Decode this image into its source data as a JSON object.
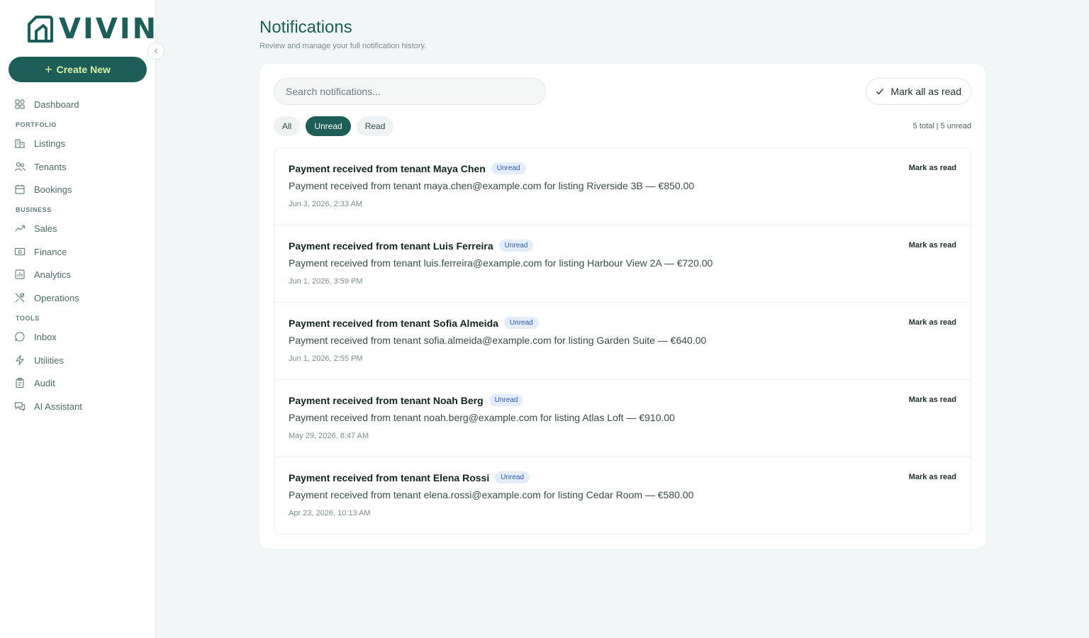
{
  "brand": {
    "name": "VIVIN",
    "color": "#1d5e58"
  },
  "sidebar": {
    "create_label": "Create New",
    "items": [
      {
        "label": "Dashboard",
        "icon": "grid-icon"
      },
      {
        "label": "Listings",
        "icon": "building-icon"
      },
      {
        "label": "Tenants",
        "icon": "users-icon"
      },
      {
        "label": "Bookings",
        "icon": "calendar-icon"
      },
      {
        "label": "Sales",
        "icon": "trending-up-icon"
      },
      {
        "label": "Finance",
        "icon": "banknote-icon"
      },
      {
        "label": "Analytics",
        "icon": "bar-chart-icon"
      },
      {
        "label": "Operations",
        "icon": "tools-icon"
      },
      {
        "label": "Inbox",
        "icon": "message-circle-icon"
      },
      {
        "label": "Utilities",
        "icon": "zap-icon"
      },
      {
        "label": "Audit",
        "icon": "clipboard-icon"
      },
      {
        "label": "AI Assistant",
        "icon": "chat-bubbles-icon"
      }
    ],
    "sections": [
      "PORTFOLIO",
      "BUSINESS",
      "TOOLS"
    ]
  },
  "header": {
    "title": "Notifications",
    "subtitle": "Review and manage your full notification history."
  },
  "toolbar": {
    "search_placeholder": "Search notifications...",
    "mark_all_label": "Mark all as read",
    "filters": [
      "All",
      "Unread",
      "Read"
    ],
    "active_filter": "Unread",
    "counts": "5 total | 5 unread"
  },
  "notifications": [
    {
      "title": "Payment received from tenant Maya Chen",
      "badge": "Unread",
      "message": "Payment received from tenant maya.chen@example.com for listing Riverside 3B — €850.00",
      "time": "Jun 3, 2026, 2:33 AM",
      "action": "Mark as read"
    },
    {
      "title": "Payment received from tenant Luis Ferreira",
      "badge": "Unread",
      "message": "Payment received from tenant luis.ferreira@example.com for listing Harbour View 2A — €720.00",
      "time": "Jun 1, 2026, 3:59 PM",
      "action": "Mark as read"
    },
    {
      "title": "Payment received from tenant Sofia Almeida",
      "badge": "Unread",
      "message": "Payment received from tenant sofia.almeida@example.com for listing Garden Suite — €640.00",
      "time": "Jun 1, 2026, 2:55 PM",
      "action": "Mark as read"
    },
    {
      "title": "Payment received from tenant Noah Berg",
      "badge": "Unread",
      "message": "Payment received from tenant noah.berg@example.com for listing Atlas Loft — €910.00",
      "time": "May 29, 2026, 8:47 AM",
      "action": "Mark as read"
    },
    {
      "title": "Payment received from tenant Elena Rossi",
      "badge": "Unread",
      "message": "Payment received from tenant elena.rossi@example.com for listing Cedar Room — €580.00",
      "time": "Apr 23, 2026, 10:13 AM",
      "action": "Mark as read"
    }
  ]
}
